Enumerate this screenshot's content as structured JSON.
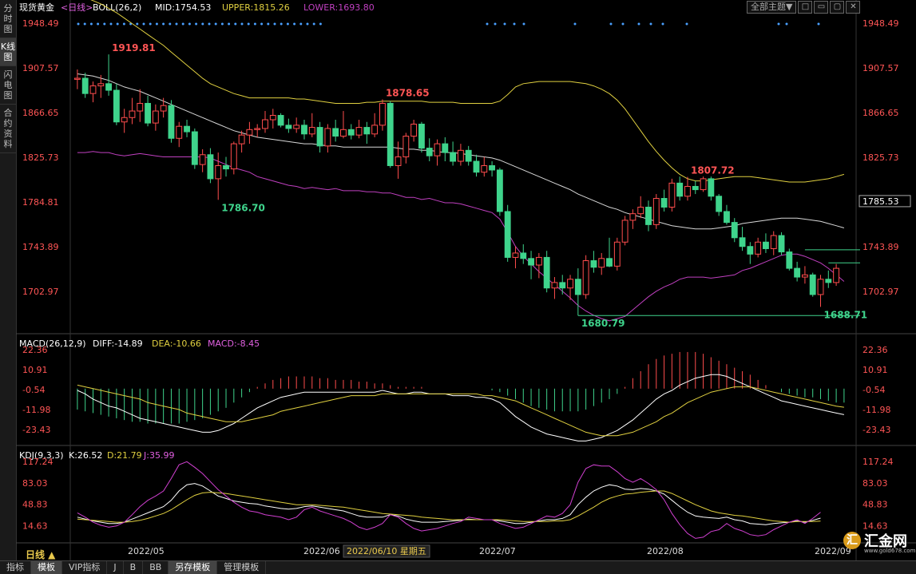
{
  "left_menu": [
    {
      "label": "分时图",
      "active": false
    },
    {
      "label": "K线图",
      "active": true
    },
    {
      "label": "闪电图",
      "active": false
    },
    {
      "label": "合约资料",
      "active": false
    }
  ],
  "toolbar": {
    "theme_label": "全部主题▼",
    "win_icons": [
      "□",
      "▭",
      "▢",
      "✕"
    ]
  },
  "period_label": "日线 ▲",
  "header": {
    "symbol": "现货黄金",
    "period": "<日线>",
    "boll": "BOLL(26,2)",
    "mid": "MID:1754.53",
    "upper": "UPPER:1815.26",
    "lower": "LOWER:1693.80"
  },
  "macd_header": {
    "name": "MACD(26,12,9)",
    "diff": "DIFF:-14.89",
    "dea": "DEA:-10.66",
    "macd": "MACD:-8.45"
  },
  "kdj_header": {
    "name": "KDJ(9,3,3)",
    "k": "K:26.52",
    "d": "D:21.79",
    "j": "J:35.99"
  },
  "price_ticks": [
    "1948.49",
    "1907.57",
    "1866.65",
    "1825.73",
    "1784.81",
    "1743.89",
    "1702.97"
  ],
  "current_price": "1785.53",
  "macd_ticks": [
    "22.36",
    "10.91",
    "-0.54",
    "-11.98",
    "-23.43"
  ],
  "kdj_ticks": [
    "117.24",
    "83.03",
    "48.83",
    "14.63"
  ],
  "date_labels": [
    "2022/05",
    "2022/06",
    "2022/07",
    "2022/08",
    "2022/09"
  ],
  "cursor_date": "2022/06/10 星期五",
  "annotations": {
    "high1": "1919.81",
    "low1": "1786.70",
    "high2": "1878.65",
    "low2": "1680.79",
    "high3": "1807.72",
    "low3": "1688.71"
  },
  "bottom_tabs": [
    {
      "label": "指标",
      "active": false
    },
    {
      "label": "模板",
      "active": true
    },
    {
      "label": "VIP指标",
      "active": false
    },
    {
      "label": "J",
      "active": false
    },
    {
      "label": "B",
      "active": false
    },
    {
      "label": "BB",
      "active": false
    },
    {
      "label": "另存模板",
      "active": true
    },
    {
      "label": "管理模板",
      "active": false
    }
  ],
  "logo": {
    "mark": "汇",
    "text": "汇金网",
    "url": "www.gold678.com"
  },
  "colors": {
    "up": "#ff4d4d",
    "down": "#3fd48c",
    "mid": "#d8d8d8",
    "upper": "#e0d040",
    "lower": "#c040c0",
    "diff": "#ffffff",
    "dea": "#e0d040",
    "k": "#ffffff",
    "d": "#e0d040",
    "j": "#d040d0"
  },
  "chart_data": {
    "type": "candlestick",
    "title": "现货黄金 <日线>",
    "ylim": [
      1670,
      1955
    ],
    "candles": [
      [
        1897,
        1906,
        1888,
        1898
      ],
      [
        1898,
        1903,
        1880,
        1884
      ],
      [
        1884,
        1895,
        1876,
        1891
      ],
      [
        1891,
        1901,
        1880,
        1893
      ],
      [
        1893,
        1919.81,
        1882,
        1887
      ],
      [
        1887,
        1893,
        1855,
        1858
      ],
      [
        1858,
        1870,
        1848,
        1862
      ],
      [
        1862,
        1880,
        1856,
        1868
      ],
      [
        1868,
        1888,
        1858,
        1875
      ],
      [
        1875,
        1882,
        1854,
        1857
      ],
      [
        1857,
        1874,
        1850,
        1868
      ],
      [
        1868,
        1880,
        1862,
        1873
      ],
      [
        1873,
        1878,
        1839,
        1843
      ],
      [
        1843,
        1858,
        1835,
        1854
      ],
      [
        1854,
        1860,
        1844,
        1849
      ],
      [
        1849,
        1852,
        1815,
        1819
      ],
      [
        1819,
        1833,
        1812,
        1828
      ],
      [
        1828,
        1834,
        1802,
        1806
      ],
      [
        1806,
        1830,
        1786.7,
        1818
      ],
      [
        1818,
        1826,
        1808,
        1815
      ],
      [
        1815,
        1840,
        1810,
        1838
      ],
      [
        1838,
        1850,
        1830,
        1846
      ],
      [
        1846,
        1858,
        1838,
        1851
      ],
      [
        1851,
        1856,
        1844,
        1852
      ],
      [
        1852,
        1868,
        1848,
        1860
      ],
      [
        1860,
        1870,
        1852,
        1864
      ],
      [
        1864,
        1866,
        1853,
        1855
      ],
      [
        1855,
        1861,
        1848,
        1852
      ],
      [
        1852,
        1862,
        1848,
        1855
      ],
      [
        1855,
        1860,
        1842,
        1847
      ],
      [
        1847,
        1866,
        1844,
        1853
      ],
      [
        1853,
        1858,
        1830,
        1836
      ],
      [
        1836,
        1856,
        1830,
        1852
      ],
      [
        1852,
        1860,
        1840,
        1845
      ],
      [
        1845,
        1868,
        1843,
        1851
      ],
      [
        1851,
        1856,
        1842,
        1846
      ],
      [
        1846,
        1860,
        1843,
        1853
      ],
      [
        1853,
        1858,
        1838,
        1847
      ],
      [
        1847,
        1866,
        1844,
        1855
      ],
      [
        1855,
        1878.65,
        1850,
        1875
      ],
      [
        1875,
        1877,
        1816,
        1818
      ],
      [
        1818,
        1840,
        1806,
        1826
      ],
      [
        1826,
        1848,
        1820,
        1845
      ],
      [
        1845,
        1860,
        1840,
        1856
      ],
      [
        1856,
        1858,
        1830,
        1834
      ],
      [
        1834,
        1843,
        1822,
        1827
      ],
      [
        1827,
        1842,
        1818,
        1838
      ],
      [
        1838,
        1844,
        1822,
        1830
      ],
      [
        1830,
        1840,
        1818,
        1822
      ],
      [
        1822,
        1838,
        1818,
        1832
      ],
      [
        1832,
        1836,
        1818,
        1822
      ],
      [
        1822,
        1828,
        1808,
        1812
      ],
      [
        1812,
        1826,
        1808,
        1818
      ],
      [
        1818,
        1822,
        1808,
        1814
      ],
      [
        1814,
        1816,
        1772,
        1776
      ],
      [
        1776,
        1782,
        1730,
        1734
      ],
      [
        1734,
        1744,
        1724,
        1738
      ],
      [
        1738,
        1746,
        1728,
        1733
      ],
      [
        1733,
        1740,
        1714,
        1727
      ],
      [
        1727,
        1738,
        1715,
        1734
      ],
      [
        1734,
        1740,
        1702,
        1706
      ],
      [
        1706,
        1716,
        1696,
        1711
      ],
      [
        1711,
        1718,
        1700,
        1706
      ],
      [
        1706,
        1718,
        1695,
        1714
      ],
      [
        1714,
        1724,
        1680.79,
        1700
      ],
      [
        1700,
        1736,
        1696,
        1731
      ],
      [
        1731,
        1740,
        1720,
        1725
      ],
      [
        1725,
        1738,
        1718,
        1733
      ],
      [
        1733,
        1752,
        1725,
        1726
      ],
      [
        1726,
        1752,
        1722,
        1748
      ],
      [
        1748,
        1772,
        1745,
        1768
      ],
      [
        1768,
        1778,
        1760,
        1774
      ],
      [
        1774,
        1790,
        1770,
        1780
      ],
      [
        1780,
        1786,
        1758,
        1764
      ],
      [
        1764,
        1792,
        1760,
        1788
      ],
      [
        1788,
        1796,
        1776,
        1780
      ],
      [
        1780,
        1806,
        1776,
        1802
      ],
      [
        1802,
        1808,
        1786,
        1790
      ],
      [
        1790,
        1807.72,
        1786,
        1799
      ],
      [
        1799,
        1804,
        1792,
        1796
      ],
      [
        1796,
        1808,
        1794,
        1806
      ],
      [
        1806,
        1808,
        1786,
        1790
      ],
      [
        1790,
        1792,
        1772,
        1776
      ],
      [
        1776,
        1782,
        1764,
        1766
      ],
      [
        1766,
        1770,
        1748,
        1752
      ],
      [
        1752,
        1762,
        1740,
        1744
      ],
      [
        1744,
        1748,
        1728,
        1737
      ],
      [
        1737,
        1752,
        1734,
        1748
      ],
      [
        1748,
        1756,
        1738,
        1742
      ],
      [
        1742,
        1758,
        1736,
        1754
      ],
      [
        1754,
        1757,
        1736,
        1739
      ],
      [
        1739,
        1742,
        1722,
        1724
      ],
      [
        1724,
        1730,
        1712,
        1716
      ],
      [
        1716,
        1726,
        1710,
        1718
      ],
      [
        1718,
        1720,
        1698,
        1700
      ],
      [
        1700,
        1718,
        1688.71,
        1714
      ],
      [
        1714,
        1722,
        1706,
        1711
      ],
      [
        1711,
        1728,
        1708,
        1724
      ]
    ],
    "boll_mid": [
      1902,
      1901,
      1900,
      1898,
      1896,
      1893,
      1890,
      1888,
      1886,
      1883,
      1880,
      1877,
      1874,
      1871,
      1868,
      1865,
      1862,
      1859,
      1856,
      1853,
      1850,
      1848,
      1846,
      1844,
      1843,
      1842,
      1841,
      1840,
      1839,
      1838,
      1838,
      1837,
      1836,
      1836,
      1835,
      1835,
      1835,
      1835,
      1835,
      1835,
      1835,
      1834,
      1833,
      1833,
      1832,
      1832,
      1831,
      1830,
      1830,
      1829,
      1828,
      1827,
      1826,
      1825,
      1823,
      1820,
      1817,
      1814,
      1811,
      1808,
      1805,
      1802,
      1799,
      1796,
      1792,
      1789,
      1786,
      1783,
      1780,
      1778,
      1775,
      1773,
      1771,
      1769,
      1767,
      1765,
      1763,
      1762,
      1761,
      1760,
      1760,
      1760,
      1761,
      1762,
      1763,
      1765,
      1766,
      1767,
      1768,
      1769,
      1770,
      1770,
      1770,
      1769,
      1768,
      1767,
      1765,
      1763,
      1761
    ],
    "boll_upper": [
      1975,
      1972,
      1969,
      1966,
      1962,
      1958,
      1953,
      1948,
      1943,
      1938,
      1933,
      1928,
      1922,
      1916,
      1910,
      1904,
      1898,
      1893,
      1890,
      1887,
      1884,
      1882,
      1880,
      1880,
      1880,
      1880,
      1880,
      1880,
      1879,
      1879,
      1878,
      1877,
      1876,
      1875,
      1875,
      1875,
      1875,
      1876,
      1876,
      1877,
      1877,
      1877,
      1877,
      1877,
      1877,
      1876,
      1876,
      1876,
      1876,
      1875,
      1875,
      1875,
      1875,
      1875,
      1877,
      1883,
      1890,
      1893,
      1894,
      1895,
      1895,
      1895,
      1895,
      1895,
      1894,
      1893,
      1891,
      1888,
      1884,
      1878,
      1870,
      1860,
      1850,
      1840,
      1831,
      1823,
      1816,
      1810,
      1806,
      1804,
      1804,
      1805,
      1806,
      1807,
      1808,
      1808,
      1808,
      1807,
      1806,
      1805,
      1804,
      1803,
      1803,
      1803,
      1804,
      1805,
      1806,
      1808,
      1810
    ],
    "boll_lower": [
      1830,
      1830,
      1831,
      1830,
      1830,
      1828,
      1827,
      1828,
      1829,
      1828,
      1827,
      1826,
      1826,
      1826,
      1826,
      1826,
      1826,
      1825,
      1822,
      1819,
      1816,
      1814,
      1812,
      1808,
      1806,
      1804,
      1802,
      1800,
      1799,
      1797,
      1798,
      1797,
      1796,
      1797,
      1795,
      1795,
      1795,
      1794,
      1794,
      1793,
      1793,
      1791,
      1789,
      1789,
      1787,
      1788,
      1786,
      1784,
      1784,
      1783,
      1781,
      1779,
      1777,
      1775,
      1769,
      1757,
      1744,
      1735,
      1728,
      1721,
      1715,
      1709,
      1703,
      1697,
      1690,
      1685,
      1681,
      1678,
      1676,
      1678,
      1680,
      1686,
      1692,
      1698,
      1703,
      1707,
      1710,
      1714,
      1716,
      1716,
      1716,
      1715,
      1716,
      1717,
      1718,
      1722,
      1724,
      1727,
      1730,
      1733,
      1736,
      1737,
      1737,
      1735,
      1732,
      1729,
      1724,
      1718,
      1712
    ],
    "macd_hist": [
      -12,
      -13,
      -14,
      -15,
      -16,
      -17,
      -18,
      -19,
      -19,
      -20,
      -20,
      -20,
      -20,
      -20,
      -19,
      -18,
      -17,
      -15,
      -13,
      -11,
      -8,
      -5,
      -2,
      1,
      3,
      5,
      6,
      7,
      7,
      7,
      7,
      6,
      6,
      5,
      5,
      5,
      4,
      4,
      3,
      3,
      2,
      1,
      1,
      1,
      1,
      0,
      0,
      0,
      0,
      0,
      0,
      0,
      0,
      -1,
      -2,
      -4,
      -6,
      -8,
      -10,
      -11,
      -12,
      -13,
      -13,
      -13,
      -13,
      -12,
      -10,
      -8,
      -6,
      -3,
      1,
      6,
      10,
      14,
      17,
      19,
      20,
      21,
      21,
      21,
      20,
      18,
      16,
      14,
      12,
      10,
      8,
      5,
      2,
      0,
      -2,
      -3,
      -4,
      -5,
      -5,
      -6,
      -7,
      -8,
      -8
    ],
    "macd_diff": [
      -1,
      -3,
      -6,
      -8,
      -10,
      -11,
      -13,
      -15,
      -17,
      -18,
      -19,
      -20,
      -21,
      -22,
      -23,
      -24,
      -25,
      -25,
      -24,
      -22,
      -20,
      -17,
      -14,
      -11,
      -9,
      -7,
      -5,
      -4,
      -3,
      -2,
      -2,
      -2,
      -2,
      -2,
      -2,
      -2,
      -2,
      -2,
      -2,
      -1,
      -2,
      -3,
      -3,
      -2,
      -2,
      -3,
      -3,
      -3,
      -4,
      -4,
      -4,
      -5,
      -5,
      -6,
      -8,
      -12,
      -16,
      -19,
      -22,
      -24,
      -26,
      -27,
      -28,
      -29,
      -30,
      -30,
      -29,
      -28,
      -26,
      -24,
      -21,
      -18,
      -14,
      -10,
      -6,
      -3,
      -1,
      2,
      4,
      6,
      7,
      8,
      8,
      7,
      5,
      3,
      1,
      -1,
      -3,
      -5,
      -7,
      -8,
      -9,
      -10,
      -11,
      -12,
      -13,
      -14,
      -14.89
    ],
    "macd_dea": [
      2,
      1,
      0,
      -1,
      -2,
      -3,
      -4,
      -5,
      -6,
      -8,
      -9,
      -10,
      -11,
      -12,
      -14,
      -15,
      -16,
      -17,
      -18,
      -19,
      -19,
      -19,
      -18,
      -17,
      -16,
      -15,
      -13,
      -12,
      -11,
      -10,
      -9,
      -8,
      -7,
      -6,
      -5,
      -4,
      -4,
      -4,
      -4,
      -3,
      -3,
      -3,
      -3,
      -3,
      -3,
      -3,
      -3,
      -3,
      -3,
      -3,
      -3,
      -3,
      -4,
      -4,
      -5,
      -6,
      -7,
      -9,
      -11,
      -13,
      -15,
      -17,
      -19,
      -21,
      -23,
      -25,
      -26,
      -27,
      -27,
      -27,
      -26,
      -25,
      -23,
      -21,
      -19,
      -16,
      -14,
      -11,
      -8,
      -6,
      -4,
      -2,
      -1,
      0,
      1,
      1,
      1,
      0,
      -1,
      -2,
      -3,
      -4,
      -5,
      -6,
      -7,
      -8,
      -9,
      -10,
      -10.66
    ],
    "kdj_k": [
      28,
      25,
      22,
      20,
      18,
      18,
      20,
      25,
      30,
      35,
      40,
      45,
      55,
      70,
      80,
      82,
      78,
      70,
      62,
      58,
      54,
      52,
      50,
      49,
      46,
      44,
      42,
      41,
      42,
      45,
      46,
      44,
      42,
      40,
      38,
      34,
      30,
      28,
      28,
      28,
      32,
      30,
      25,
      22,
      20,
      20,
      20,
      21,
      22,
      23,
      25,
      24,
      24,
      24,
      22,
      20,
      18,
      18,
      20,
      22,
      24,
      24,
      26,
      32,
      48,
      60,
      70,
      76,
      80,
      78,
      73,
      72,
      74,
      73,
      70,
      65,
      55,
      45,
      36,
      30,
      28,
      27,
      26,
      28,
      24,
      22,
      18,
      17,
      16,
      18,
      19,
      20,
      22,
      20,
      23,
      26.52
    ],
    "kdj_d": [
      25,
      24,
      23,
      22,
      21,
      20,
      20,
      21,
      23,
      26,
      30,
      34,
      40,
      48,
      56,
      63,
      67,
      68,
      67,
      66,
      64,
      62,
      60,
      58,
      56,
      54,
      52,
      50,
      48,
      48,
      48,
      47,
      46,
      45,
      44,
      42,
      40,
      38,
      36,
      34,
      33,
      32,
      31,
      30,
      28,
      27,
      26,
      25,
      24,
      24,
      24,
      24,
      24,
      24,
      24,
      23,
      22,
      21,
      21,
      21,
      21,
      22,
      22,
      24,
      30,
      37,
      44,
      52,
      58,
      62,
      65,
      66,
      68,
      69,
      70,
      70,
      66,
      60,
      54,
      48,
      43,
      38,
      35,
      33,
      31,
      30,
      28,
      26,
      24,
      22,
      21,
      20,
      21,
      21,
      21,
      21.79
    ],
    "kdj_j": [
      35,
      28,
      20,
      15,
      12,
      14,
      20,
      32,
      45,
      55,
      62,
      70,
      90,
      112,
      117,
      108,
      98,
      85,
      72,
      62,
      52,
      44,
      38,
      36,
      32,
      30,
      28,
      24,
      28,
      40,
      44,
      38,
      34,
      30,
      26,
      20,
      12,
      8,
      12,
      18,
      32,
      28,
      18,
      10,
      6,
      8,
      10,
      14,
      18,
      21,
      28,
      26,
      24,
      24,
      18,
      14,
      10,
      12,
      18,
      24,
      30,
      28,
      34,
      48,
      84,
      106,
      112,
      110,
      110,
      101,
      90,
      84,
      90,
      82,
      72,
      56,
      34,
      16,
      2,
      -6,
      -4,
      5,
      8,
      18,
      10,
      6,
      0,
      -2,
      0,
      8,
      14,
      20,
      24,
      18,
      26,
      35.99
    ]
  }
}
